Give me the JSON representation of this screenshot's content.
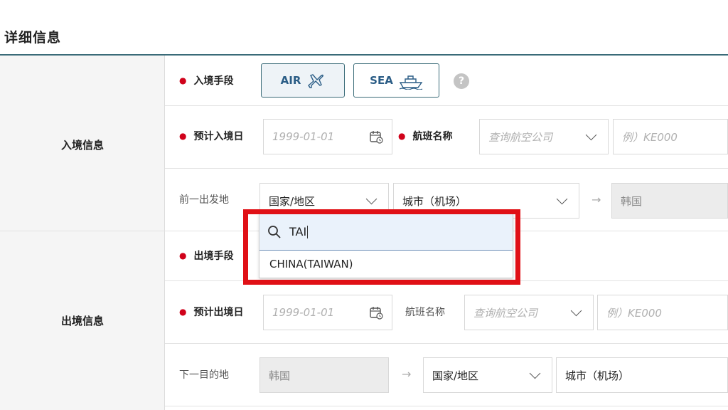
{
  "section_title": "详细信息",
  "entry": {
    "group_label": "入境信息",
    "transport_label": "入境手段",
    "air_label": "AIR",
    "sea_label": "SEA",
    "help_label": "?",
    "date_label": "预计入境日",
    "date_placeholder": "1999-01-01",
    "flight_label": "航班名称",
    "airline_placeholder": "查询航空公司",
    "flight_placeholder": "例）KE000",
    "prev_label": "前一出发地",
    "country_value": "国家/地区",
    "city_value": "城市（机场）",
    "dest_value": "韩国"
  },
  "exit": {
    "group_label": "出境信息",
    "transport_label": "出境手段",
    "date_label": "预计出境日",
    "date_placeholder": "1999-01-01",
    "flight_label": "航班名称",
    "airline_placeholder": "查询航空公司",
    "flight_placeholder": "例）KE000",
    "next_label": "下一目的地",
    "origin_value": "韩国",
    "country_value": "国家/地区",
    "city_value": "城市（机场）"
  },
  "dropdown": {
    "search_value": "TAI",
    "options": [
      "CHINA(TAIWAN)"
    ]
  },
  "colors": {
    "accent": "#3a6b78",
    "required": "#d0021b",
    "highlight": "#e01016"
  }
}
